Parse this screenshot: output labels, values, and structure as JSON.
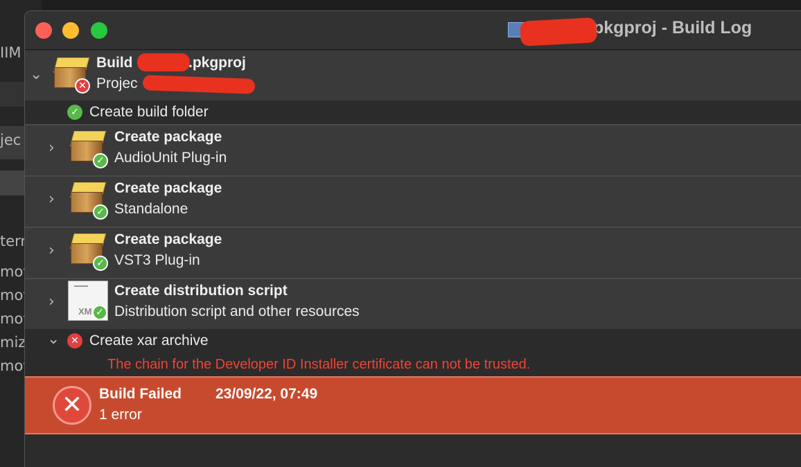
{
  "background_window": {
    "fragments": [
      "IIM",
      "jec",
      "tern",
      "move",
      "move",
      "move",
      "miz",
      "move"
    ]
  },
  "window": {
    "title": "pkgproj - Build Log"
  },
  "log": {
    "build": {
      "title": "Build",
      "title_suffix": ".pkgproj",
      "subtitle": "Projec"
    },
    "steps": [
      {
        "title": "Create build folder",
        "status": "success"
      },
      {
        "title": "Create package",
        "subtitle": "AudioUnit Plug-in",
        "status": "success"
      },
      {
        "title": "Create package",
        "subtitle": "Standalone",
        "status": "success"
      },
      {
        "title": "Create package",
        "subtitle": "VST3 Plug-in",
        "status": "success"
      },
      {
        "title": "Create distribution script",
        "subtitle": "Distribution script and other resources",
        "status": "success",
        "icon_label": "XM"
      },
      {
        "title": "Create xar archive",
        "status": "error",
        "error_message": "The chain for the Developer ID Installer certificate can not be trusted."
      }
    ]
  },
  "result": {
    "title": "Build Failed",
    "timestamp": "23/09/22, 07:49",
    "summary": "1 error"
  },
  "colors": {
    "fail_bar": "#c84a2e",
    "error_text": "#f04434",
    "success_badge": "#58b94a",
    "error_badge": "#e04040"
  }
}
